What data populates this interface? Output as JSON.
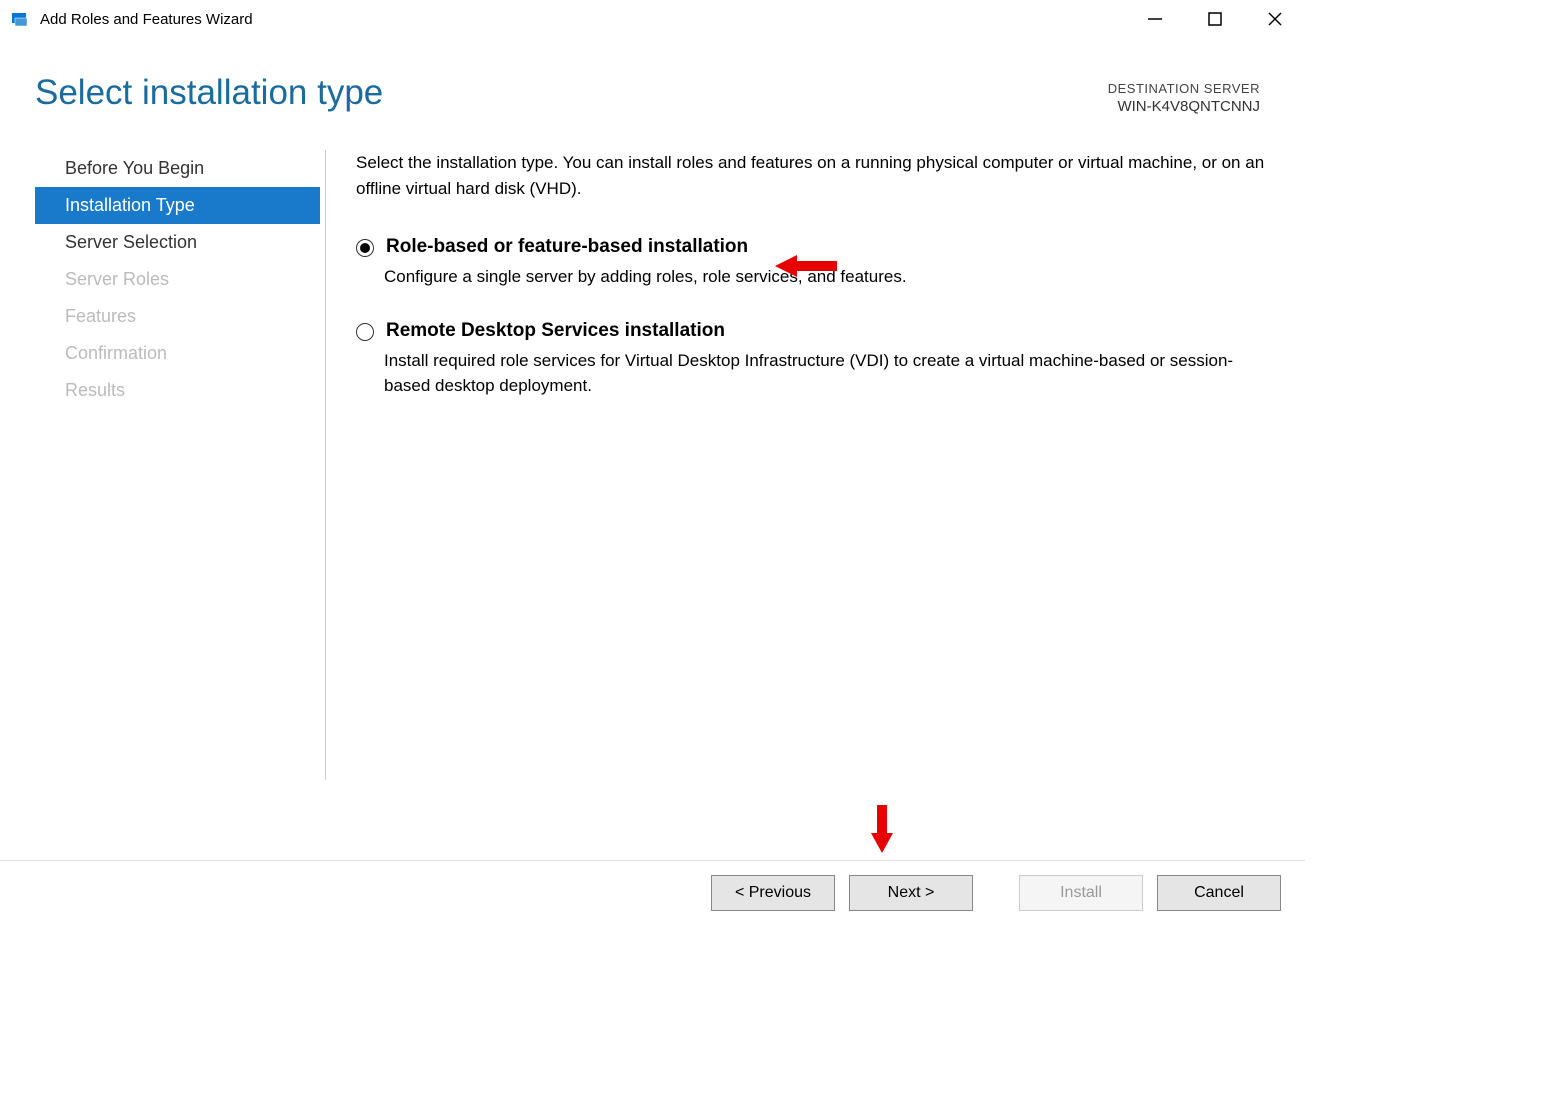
{
  "window": {
    "title": "Add Roles and Features Wizard"
  },
  "header": {
    "page_title": "Select installation type",
    "destination_label": "DESTINATION SERVER",
    "destination_server": "WIN-K4V8QNTCNNJ"
  },
  "sidebar": {
    "items": [
      {
        "label": "Before You Begin",
        "state": "normal"
      },
      {
        "label": "Installation Type",
        "state": "selected"
      },
      {
        "label": "Server Selection",
        "state": "normal"
      },
      {
        "label": "Server Roles",
        "state": "disabled"
      },
      {
        "label": "Features",
        "state": "disabled"
      },
      {
        "label": "Confirmation",
        "state": "disabled"
      },
      {
        "label": "Results",
        "state": "disabled"
      }
    ]
  },
  "content": {
    "intro": "Select the installation type. You can install roles and features on a running physical computer or virtual machine, or on an offline virtual hard disk (VHD).",
    "options": [
      {
        "title": "Role-based or feature-based installation",
        "description": "Configure a single server by adding roles, role services, and features.",
        "selected": true
      },
      {
        "title": "Remote Desktop Services installation",
        "description": "Install required role services for Virtual Desktop Infrastructure (VDI) to create a virtual machine-based or session-based desktop deployment.",
        "selected": false
      }
    ]
  },
  "footer": {
    "previous": "< Previous",
    "next": "Next >",
    "install": "Install",
    "cancel": "Cancel"
  }
}
